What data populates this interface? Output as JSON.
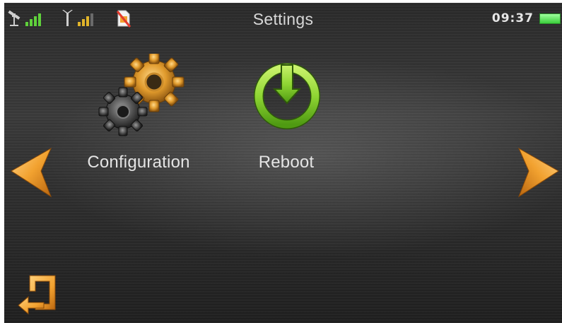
{
  "header": {
    "title": "Settings",
    "time": "09:37"
  },
  "status_icons": [
    "satellite-signal-icon",
    "cellular-signal-icon",
    "no-sim-card-icon",
    "battery-icon"
  ],
  "apps": [
    {
      "label": "Configuration",
      "icon": "gears-icon"
    },
    {
      "label": "Reboot",
      "icon": "power-reboot-icon"
    }
  ],
  "navigation": {
    "prev_icon": "left-arrow-icon",
    "next_icon": "right-arrow-icon",
    "back_icon": "back-return-icon"
  },
  "colors": {
    "accent_orange": "#f2a230",
    "reboot_green": "#8fd633",
    "battery_green": "#4cd94c",
    "signal_green": "#5fd13b",
    "signal_yellow": "#e0b42a",
    "sim_red": "#e33b2e"
  }
}
